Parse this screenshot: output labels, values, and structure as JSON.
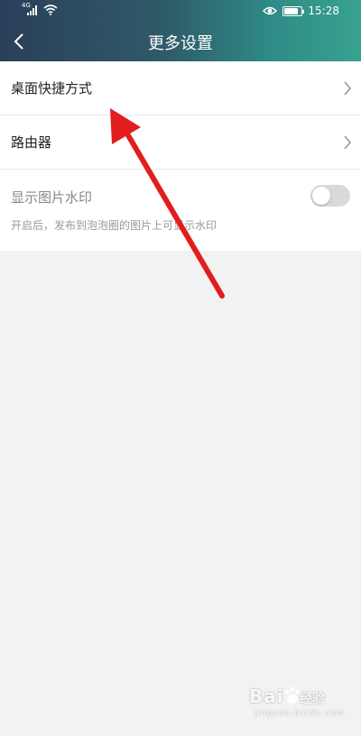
{
  "status_bar": {
    "network": "4G",
    "time": "15:28",
    "icons": [
      "signal-icon",
      "wifi-icon",
      "eye-icon",
      "battery-icon"
    ],
    "battery_level": 0.85
  },
  "header": {
    "title": "更多设置",
    "back_icon": "chevron-left-icon"
  },
  "settings": {
    "items": [
      {
        "label": "桌面快捷方式",
        "icon": "chevron-right-icon"
      },
      {
        "label": "路由器",
        "icon": "chevron-right-icon"
      }
    ],
    "watermark_setting": {
      "label": "显示图片水印",
      "description": "开启后，发布到泡泡圈的图片上可显示水印",
      "enabled": false
    }
  },
  "annotation": {
    "color": "#e11d1d"
  },
  "watermark": {
    "logo_text": "Bai",
    "logo_suffix": "经验",
    "url": "jingyan.baidu.com"
  },
  "colors": {
    "header_start": "#2a3f5a",
    "header_end": "#38a290",
    "background": "#f2f2f2"
  }
}
